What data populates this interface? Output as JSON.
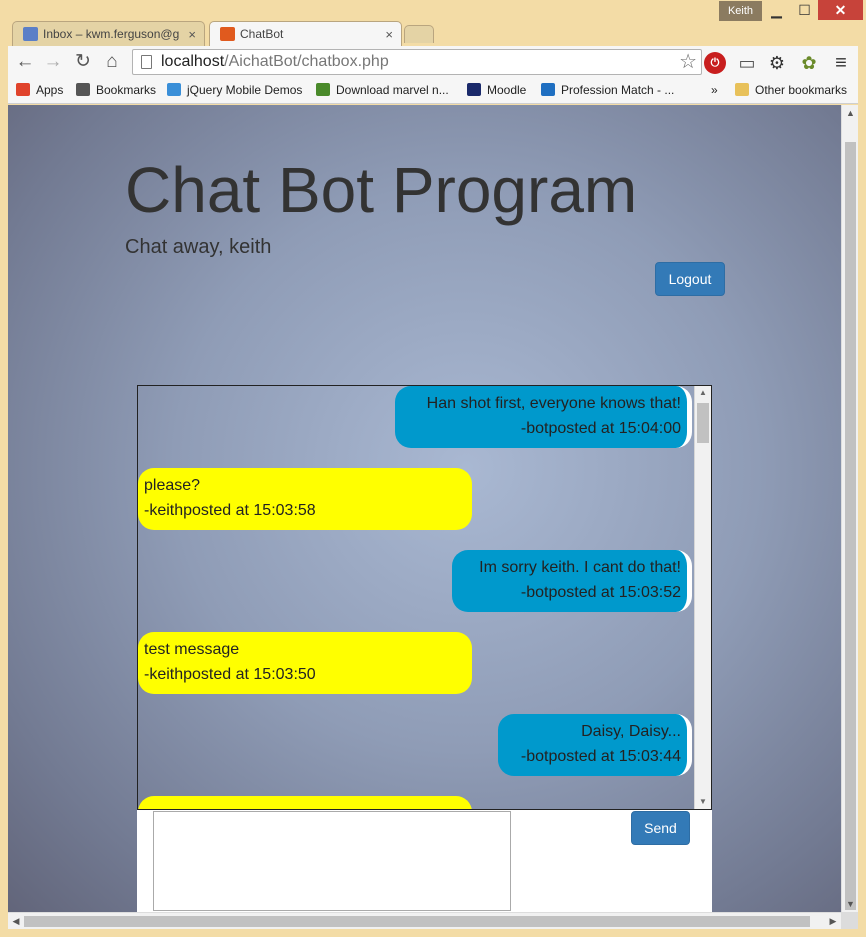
{
  "window": {
    "user": "Keith",
    "minimize": "▁",
    "maximize": "☐",
    "close": "✕"
  },
  "tabs": [
    {
      "label": "Inbox – kwm.ferguson@g",
      "close": "×",
      "icon_color": "#5b7fc7"
    },
    {
      "label": "ChatBot",
      "close": "×",
      "icon_color": "#e05a1e"
    }
  ],
  "toolbar": {
    "back": "←",
    "forward": "→",
    "reload": "↻",
    "home": "⌂",
    "url_host": "localhost",
    "url_path": "/AichatBot/chatbox.php",
    "star": "☆",
    "stop_ext": "⏻",
    "cast": "▭",
    "gear": "⚙",
    "extension": "✿",
    "menu": "≡"
  },
  "bookmarks": {
    "items": [
      {
        "label": "Apps",
        "color": "#e0432b"
      },
      {
        "label": "Bookmarks",
        "color": "#555555"
      },
      {
        "label": "jQuery Mobile Demos",
        "color": "#3a8fd8"
      },
      {
        "label": "Download marvel n...",
        "color": "#4a8a2a"
      },
      {
        "label": "Moodle",
        "color": "#1b2a6b"
      },
      {
        "label": "Profession Match - ...",
        "color": "#1f6fc1"
      }
    ],
    "overflow": "»",
    "other": "Other bookmarks"
  },
  "page": {
    "title": "Chat Bot Program",
    "subtitle": "Chat away, keith",
    "logout_label": "Logout",
    "send_label": "Send",
    "message_input_value": ""
  },
  "messages": [
    {
      "sender": "bot",
      "text": "Han shot first, everyone knows that!",
      "meta": "-botposted at 15:04:00"
    },
    {
      "sender": "user",
      "text": "please?",
      "meta": "-keithposted at 15:03:58"
    },
    {
      "sender": "bot",
      "text": "Im sorry keith. I cant do that!",
      "meta": "-botposted at 15:03:52"
    },
    {
      "sender": "user",
      "text": "test message",
      "meta": "-keithposted at 15:03:50"
    },
    {
      "sender": "bot",
      "text": "Daisy, Daisy...",
      "meta": "-botposted at 15:03:44"
    },
    {
      "sender": "user",
      "text": "",
      "meta": ""
    }
  ],
  "colors": {
    "bot_bubble": "#0099cc",
    "user_bubble": "#ffff00",
    "button_primary": "#337ab7"
  }
}
